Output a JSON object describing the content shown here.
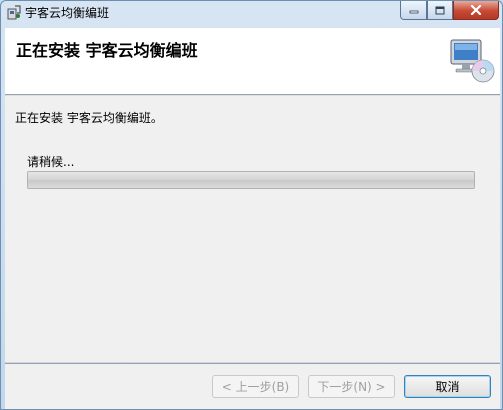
{
  "window": {
    "title": "宇客云均衡编班",
    "controls": {
      "minimize_icon": "minimize-icon",
      "maximize_icon": "maximize-icon",
      "close_icon": "close-icon"
    }
  },
  "header": {
    "title": "正在安装 宇客云均衡编班",
    "graphic_icon": "computer-disc-icon"
  },
  "body": {
    "status": "正在安装 宇客云均衡编班。",
    "wait_label": "请稍候...",
    "progress_fraction": 0.0
  },
  "footer": {
    "back_label": "< 上一步(B)",
    "next_label": "下一步(N) >",
    "cancel_label": "取消"
  }
}
